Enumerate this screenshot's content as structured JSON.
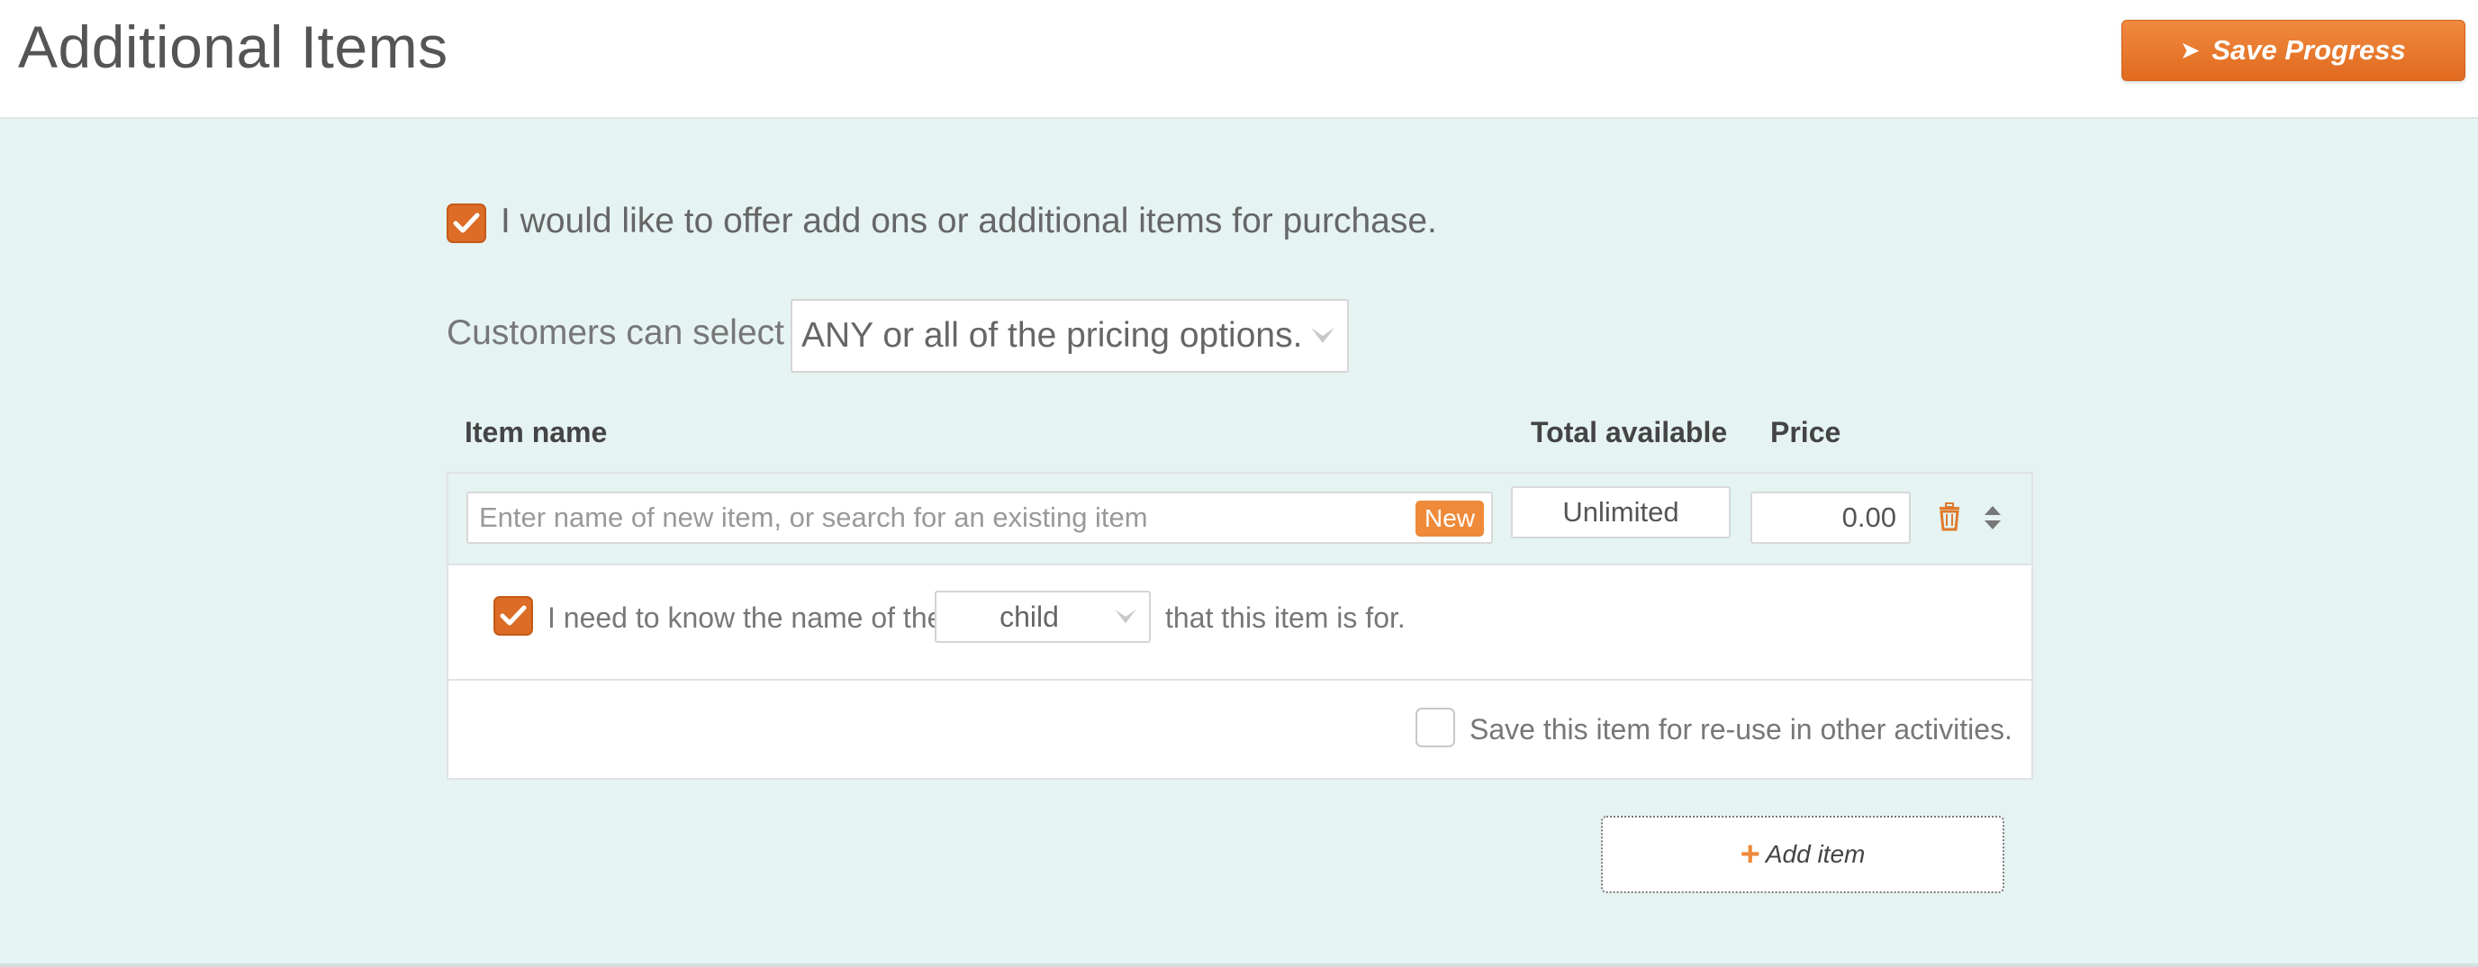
{
  "header": {
    "title": "Additional Items",
    "save_label": "Save Progress"
  },
  "offer": {
    "checked": true,
    "label": "I would like to offer add ons or additional items for purchase."
  },
  "selection": {
    "label": "Customers can select",
    "value": "ANY or all of the pricing options."
  },
  "columns": {
    "item_name": "Item name",
    "total_available": "Total available",
    "price": "Price"
  },
  "item": {
    "name_placeholder": "Enter name of new item, or search for an existing item",
    "new_badge": "New",
    "total_available": "Unlimited",
    "price": "0.00",
    "need_name_checked": true,
    "need_name_prefix": "I need to know the name of the",
    "person_type": "child",
    "need_name_suffix": "that this item is for.",
    "reuse_checked": false,
    "reuse_label": "Save this item for re-use in other activities."
  },
  "add_item_label": "Add item",
  "colors": {
    "accent": "#dc6c26",
    "badge": "#ee8a3a",
    "background": "#e5f3f2"
  }
}
